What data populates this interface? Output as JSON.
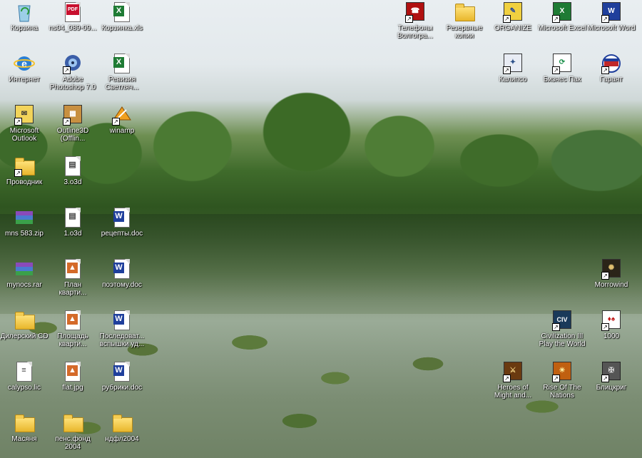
{
  "desktop": {
    "icons": [
      {
        "label": "Корзина",
        "icon": "recycle-bin-icon",
        "color": "#5fa8d8"
      },
      {
        "label": "ns04_089-09...",
        "icon": "pdf-file-icon",
        "color": "#c8102e"
      },
      {
        "label": "Корзинка.xls",
        "icon": "excel-file-icon",
        "color": "#1e7b34"
      },
      {
        "label": "Телефоны\nВолгогра...",
        "icon": "phonebook-shortcut-icon",
        "color": "#b01010"
      },
      {
        "label": "Резервные\nкопии",
        "icon": "folder-icon",
        "color": "#e8b62c"
      },
      {
        "label": "ORGANIZE",
        "icon": "organize-shortcut-icon",
        "color": "#2a4a9a"
      },
      {
        "label": "Microsoft Excel",
        "icon": "excel-app-icon",
        "color": "#1e7b34"
      },
      {
        "label": "Microsoft Word",
        "icon": "word-app-icon",
        "color": "#1f3f9c"
      },
      {
        "label": "Интернет",
        "icon": "internet-explorer-icon",
        "color": "#2a7fd4"
      },
      {
        "label": "Adobe\nPhotoshop 7.0",
        "icon": "photoshop-icon",
        "color": "#3b5ea8"
      },
      {
        "label": "Ревизия\nСветляч...",
        "icon": "excel-file-icon",
        "color": "#1e7b34"
      },
      {
        "label": "Калипсо",
        "icon": "calypso-shortcut-icon",
        "color": "#2b4f8a"
      },
      {
        "label": "Бизнес Пак",
        "icon": "business-pack-icon",
        "color": "#1a8f4a"
      },
      {
        "label": "Гарант",
        "icon": "garant-icon",
        "color": "#c0282a"
      },
      {
        "label": "Microsoft\nOutlook",
        "icon": "outlook-icon",
        "color": "#d9a520"
      },
      {
        "label": "Outline3D\n(Offlin...",
        "icon": "outline3d-icon",
        "color": "#8a5a20"
      },
      {
        "label": "winamp",
        "icon": "winamp-icon",
        "color": "#e58a10"
      },
      {
        "label": "Проводник",
        "icon": "explorer-icon",
        "color": "#e8b62c"
      },
      {
        "label": "3.o3d",
        "icon": "o3d-file-icon",
        "color": "#444444"
      },
      {
        "label": "mns 583.zip",
        "icon": "archive-icon",
        "color": "#7a3c9a"
      },
      {
        "label": "1.o3d",
        "icon": "o3d-file-icon",
        "color": "#444444"
      },
      {
        "label": "рецепты.doc",
        "icon": "word-file-icon",
        "color": "#1f3f9c"
      },
      {
        "label": "mynocs.rar",
        "icon": "archive-icon",
        "color": "#7a3c9a"
      },
      {
        "label": "План\nкварти...",
        "icon": "image-file-icon",
        "color": "#d46a2a"
      },
      {
        "label": "поэтому.doc",
        "icon": "word-file-icon",
        "color": "#1f3f9c"
      },
      {
        "label": "Morrowind",
        "icon": "morrowind-icon",
        "color": "#a08a50"
      },
      {
        "label": "Дилерский CD",
        "icon": "folder-icon",
        "color": "#e8b62c"
      },
      {
        "label": "Площадь\nкварти...",
        "icon": "image-file-icon",
        "color": "#d46a2a"
      },
      {
        "label": "Последоват...\nвспышки уд...",
        "icon": "word-file-icon",
        "color": "#1f3f9c"
      },
      {
        "label": "Civilization III\nPlay the World",
        "icon": "civilization-icon",
        "color": "#2a5a8a"
      },
      {
        "label": "1000",
        "icon": "cards-game-icon",
        "color": "#c01818"
      },
      {
        "label": "calypso.lic",
        "icon": "license-file-icon",
        "color": "#444444"
      },
      {
        "label": "flat.jpg",
        "icon": "image-file-icon",
        "color": "#d46a2a"
      },
      {
        "label": "рубрики.doc",
        "icon": "word-file-icon",
        "color": "#1f3f9c"
      },
      {
        "label": "Heroes of\nMight and...",
        "icon": "heroes-game-icon",
        "color": "#6a3a10"
      },
      {
        "label": "Rise Of The\nNations",
        "icon": "rise-of-nations-icon",
        "color": "#c06010"
      },
      {
        "label": "Блицкриг",
        "icon": "blitzkrieg-icon",
        "color": "#555555"
      },
      {
        "label": "Масяня",
        "icon": "folder-icon",
        "color": "#e8b62c"
      },
      {
        "label": "пенс.фонд\n2004",
        "icon": "folder-icon",
        "color": "#e8b62c"
      },
      {
        "label": "ндфл2004",
        "icon": "folder-icon",
        "color": "#e8b62c"
      }
    ]
  }
}
